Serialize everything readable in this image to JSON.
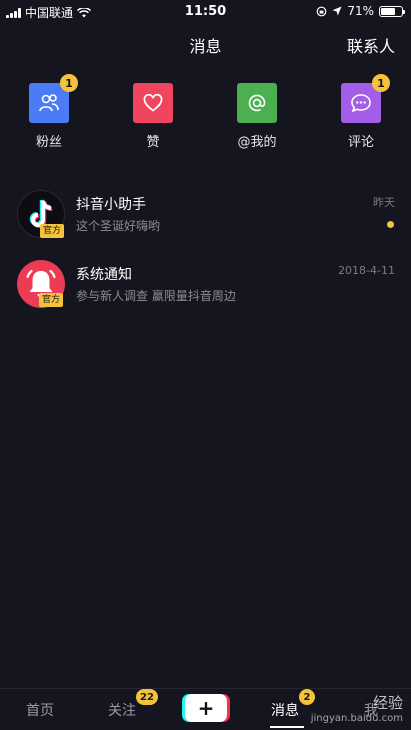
{
  "status_bar": {
    "carrier": "中国联通",
    "time": "11:50",
    "battery": "71%",
    "battery_level": 0.71
  },
  "header": {
    "title": "消息",
    "contacts": "联系人"
  },
  "categories": [
    {
      "label": "粉丝",
      "icon": "fans-icon",
      "color": "#4b7bf5",
      "badge": "1"
    },
    {
      "label": "赞",
      "icon": "heart-icon",
      "color": "#f0455e",
      "badge": ""
    },
    {
      "label": "@我的",
      "icon": "at-icon",
      "color": "#4caf50",
      "badge": ""
    },
    {
      "label": "评论",
      "icon": "comment-icon",
      "color": "#a45de6",
      "badge": "1"
    }
  ],
  "messages": [
    {
      "name": "抖音小助手",
      "preview": "这个圣诞好嗨哟",
      "time": "昨天",
      "official": "官方",
      "unread": true
    },
    {
      "name": "系统通知",
      "preview": "参与新人调查 赢限量抖音周边",
      "time": "2018-4-11",
      "official": "官方",
      "unread": false
    }
  ],
  "tabbar": {
    "home": "首页",
    "follow": "关注",
    "follow_badge": "22",
    "add": "+",
    "messages": "消息",
    "messages_badge": "2",
    "me": "我"
  },
  "watermark": {
    "brand": "经验",
    "url": "jingyan.baidu.com"
  }
}
